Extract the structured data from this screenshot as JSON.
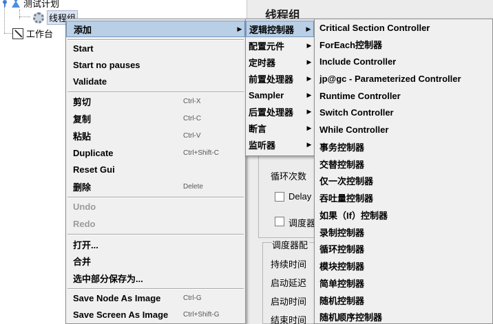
{
  "tree": {
    "test_plan": "测试计划",
    "thread_group": "线程组",
    "workbench": "工作台"
  },
  "right_panel": {
    "title": "线程组",
    "loop_count_label": "循环次数",
    "delay_label": "Delay",
    "scheduler_label": "调度器",
    "scheduler_config_label": "调度器配",
    "duration_label": "持续时间",
    "startup_delay_label": "启动延迟",
    "start_time_label": "启动时间",
    "end_time_label": "结束时间"
  },
  "main_menu": {
    "add": "添加",
    "start": "Start",
    "start_no_pauses": "Start no pauses",
    "validate": "Validate",
    "cut": "剪切",
    "cut_acc": "Ctrl-X",
    "copy": "复制",
    "copy_acc": "Ctrl-C",
    "paste": "粘贴",
    "paste_acc": "Ctrl-V",
    "duplicate": "Duplicate",
    "duplicate_acc": "Ctrl+Shift-C",
    "reset_gui": "Reset Gui",
    "delete": "删除",
    "delete_acc": "Delete",
    "undo": "Undo",
    "redo": "Redo",
    "open": "打开...",
    "merge": "合并",
    "save_selection": "选中部分保存为...",
    "save_node_image": "Save Node As Image",
    "save_node_image_acc": "Ctrl-G",
    "save_screen_image": "Save Screen As Image",
    "save_screen_image_acc": "Ctrl+Shift-G"
  },
  "add_menu": {
    "items": [
      "逻辑控制器",
      "配置元件",
      "定时器",
      "前置处理器",
      "Sampler",
      "后置处理器",
      "断言",
      "监听器"
    ]
  },
  "logic_menu": {
    "items": [
      "Critical Section Controller",
      "ForEach控制器",
      "Include Controller",
      "jp@gc - Parameterized Controller",
      "Runtime Controller",
      "Switch Controller",
      "While Controller",
      "事务控制器",
      "交替控制器",
      "仅一次控制器",
      "吞吐量控制器",
      "如果（If）控制器",
      "录制控制器",
      "循环控制器",
      "模块控制器",
      "简单控制器",
      "随机控制器",
      "随机顺序控制器"
    ]
  },
  "colors": {
    "menu_bg": "#f0f0f0",
    "highlight_bg": "#b8cfe5",
    "disabled_text": "#9b9b9b",
    "icon_blue": "#3d7dd8"
  },
  "icons": {
    "test_plan": "flask-icon",
    "thread_group": "gear-icon",
    "workbench": "workbench-icon",
    "submenu": "submenu-arrow-icon"
  }
}
